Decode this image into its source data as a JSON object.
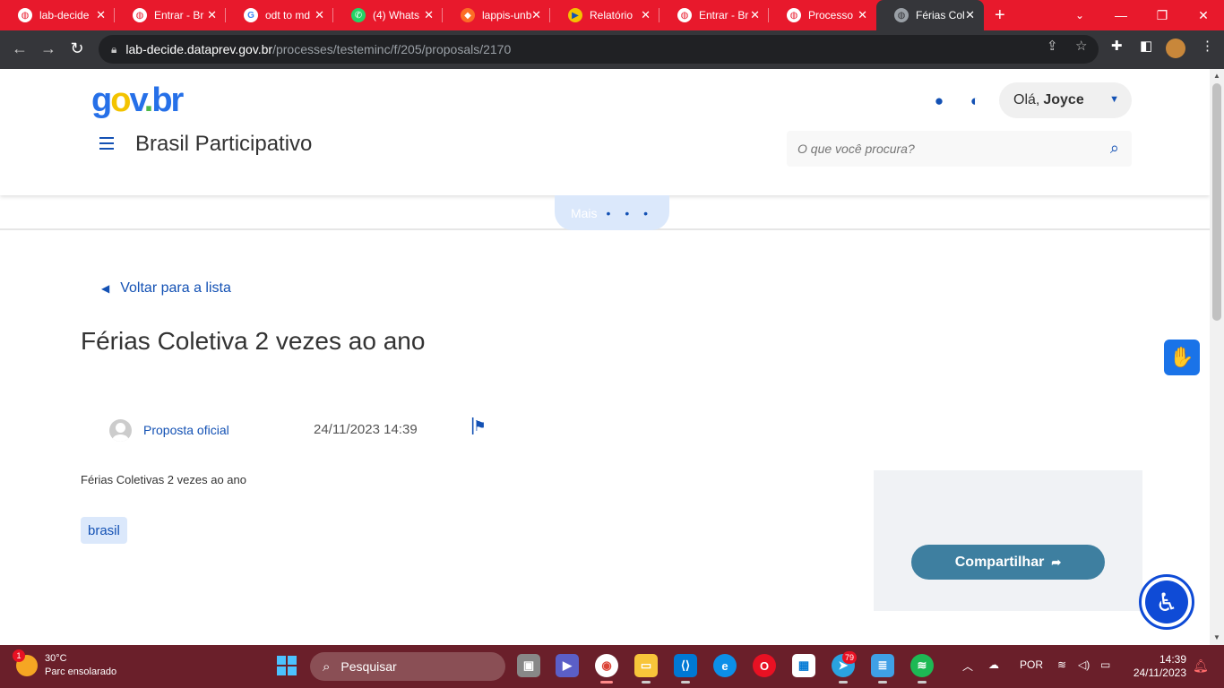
{
  "browser": {
    "tabs": [
      {
        "label": "lab-decide",
        "favicon": "globe-icon",
        "active": false
      },
      {
        "label": "Entrar - Br",
        "favicon": "globe-icon",
        "active": false
      },
      {
        "label": "odt to md",
        "favicon": "google-icon",
        "active": false
      },
      {
        "label": "(4) Whats",
        "favicon": "whatsapp-icon",
        "active": false
      },
      {
        "label": "lappis-unb",
        "favicon": "gitlab-icon",
        "active": false
      },
      {
        "label": "Relatório",
        "favicon": "gov-icon",
        "active": false
      },
      {
        "label": "Entrar - Br",
        "favicon": "globe-icon",
        "active": false
      },
      {
        "label": "Processo",
        "favicon": "globe-icon",
        "active": false
      },
      {
        "label": "Férias Col",
        "favicon": "globe-icon",
        "active": true
      }
    ],
    "url_host": "lab-decide.dataprev.gov.br",
    "url_path": "/processes/testeminc/f/205/proposals/2170"
  },
  "header": {
    "logo": {
      "g": "g",
      "o": "o",
      "v": "v",
      "dot": ".",
      "br": "br"
    },
    "site_title": "Brasil Participativo",
    "greeting": "Olá,",
    "user_name": "Joyce",
    "search_placeholder": "O que você procura?"
  },
  "menu": {
    "more_label": "Mais",
    "more_dots": "• • •"
  },
  "proposal": {
    "back_label": "Voltar para a lista",
    "title": "Férias Coletiva 2 vezes ao ano",
    "author": "Proposta oficial",
    "date": "24/11/2023 14:39",
    "body": "Férias Coletivas 2 vezes ao ano",
    "tag": "brasil"
  },
  "sidebar": {
    "share_label": "Compartilhar"
  },
  "taskbar": {
    "weather_badge": "1",
    "temperature": "30°C",
    "weather_desc": "Parc ensolarado",
    "search_label": "Pesquisar",
    "telegram_badge": "79",
    "language": "POR",
    "time": "14:39",
    "date": "24/11/2023"
  },
  "colors": {
    "tab_bar": "#e8192c",
    "gov_blue": "#1351b4",
    "share_button": "#3e7fa0",
    "taskbar": "#6a1f2a"
  }
}
